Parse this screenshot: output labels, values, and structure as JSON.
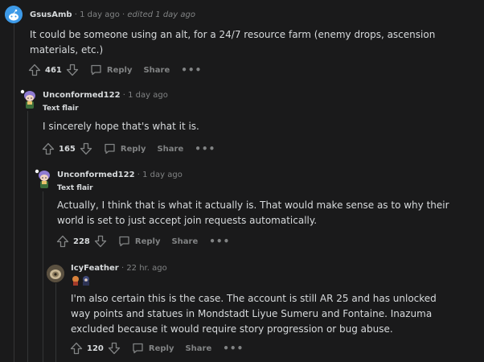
{
  "actions": {
    "reply_label": "Reply",
    "share_label": "Share",
    "more_label": "•••"
  },
  "separator": "·",
  "comments": [
    {
      "username": "GsusAmb",
      "time": "1 day ago",
      "edited": "edited 1 day ago",
      "flair": "",
      "text": "It could be someone using an alt, for a 24/7 resource farm (enemy drops, ascension materials, etc.)",
      "score": "461"
    },
    {
      "username": "Unconformed122",
      "time": "1 day ago",
      "edited": "",
      "flair": "Text flair",
      "text": "I sincerely hope that's what it is.",
      "score": "165"
    },
    {
      "username": "Unconformed122",
      "time": "1 day ago",
      "edited": "",
      "flair": "Text flair",
      "text": "Actually, I think that is what it actually is. That would make sense as to why their world is set to just accept join requests automatically.",
      "score": "228"
    },
    {
      "username": "IcyFeather",
      "time": "22 hr. ago",
      "edited": "",
      "flair": "",
      "text": "I'm also certain this is the case. The account is still AR 25 and has unlocked way points and statues in Mondstadt Liyue Sumeru and Fontaine. Inazuma excluded because it would require story progression or bug abuse.",
      "score": "120"
    }
  ],
  "colors": {
    "background": "#1a1a1b",
    "text": "#d7dadc",
    "muted": "#818384",
    "thread_line": "#343536",
    "snoo_blue": "#3d9ae8"
  }
}
